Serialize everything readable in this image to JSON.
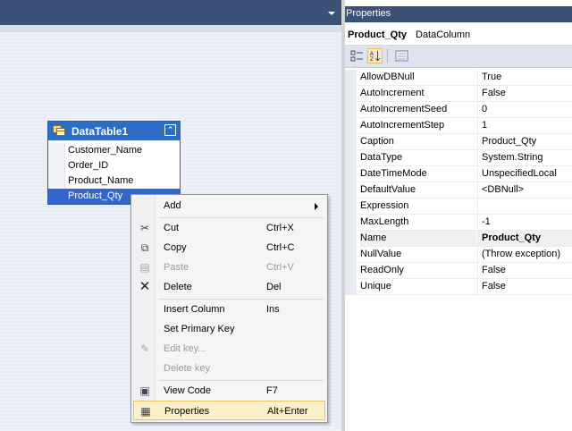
{
  "properties": {
    "title": "Properties",
    "object_name": "Product_Qty",
    "object_type": "DataColumn",
    "rows": [
      {
        "name": "AllowDBNull",
        "value": "True"
      },
      {
        "name": "AutoIncrement",
        "value": "False"
      },
      {
        "name": "AutoIncrementSeed",
        "value": "0"
      },
      {
        "name": "AutoIncrementStep",
        "value": "1"
      },
      {
        "name": "Caption",
        "value": "Product_Qty"
      },
      {
        "name": "DataType",
        "value": "System.String"
      },
      {
        "name": "DateTimeMode",
        "value": "UnspecifiedLocal"
      },
      {
        "name": "DefaultValue",
        "value": "<DBNull>"
      },
      {
        "name": "Expression",
        "value": ""
      },
      {
        "name": "MaxLength",
        "value": "-1"
      },
      {
        "name": "Name",
        "value": "Product_Qty"
      },
      {
        "name": "NullValue",
        "value": "(Throw exception)"
      },
      {
        "name": "ReadOnly",
        "value": "False"
      },
      {
        "name": "Unique",
        "value": "False"
      }
    ]
  },
  "datatable": {
    "title": "DataTable1",
    "columns": [
      "Customer_Name",
      "Order_ID",
      "Product_Name",
      "Product_Qty"
    ],
    "selected_column": "Product_Qty"
  },
  "context_menu": {
    "add": {
      "label": "Add"
    },
    "cut": {
      "label": "Cut",
      "shortcut": "Ctrl+X"
    },
    "copy": {
      "label": "Copy",
      "shortcut": "Ctrl+C"
    },
    "paste": {
      "label": "Paste",
      "shortcut": "Ctrl+V"
    },
    "delete": {
      "label": "Delete",
      "shortcut": "Del"
    },
    "insert_column": {
      "label": "Insert Column",
      "shortcut": "Ins"
    },
    "set_primary_key": {
      "label": "Set Primary Key"
    },
    "edit_key": {
      "label": "Edit key..."
    },
    "delete_key": {
      "label": "Delete key"
    },
    "view_code": {
      "label": "View Code",
      "shortcut": "F7"
    },
    "properties": {
      "label": "Properties",
      "shortcut": "Alt+Enter"
    }
  },
  "colors": {
    "header_blue": "#3b5178",
    "table_header": "#2c6dc8",
    "selection": "#3366cc",
    "menu_highlight": "#fdf0c8"
  }
}
